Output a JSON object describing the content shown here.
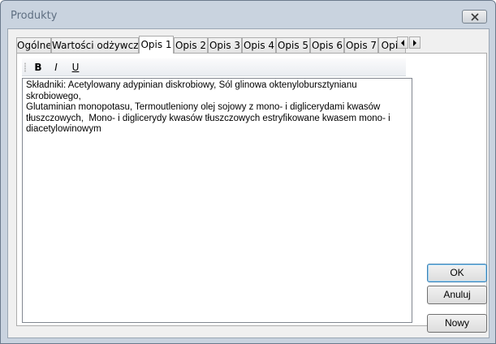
{
  "window": {
    "title": "Produkty"
  },
  "tabs": [
    {
      "label": "Ogólne",
      "active": false
    },
    {
      "label": "Wartości odżywcze",
      "active": false
    },
    {
      "label": "Opis 1",
      "active": true
    },
    {
      "label": "Opis 2",
      "active": false
    },
    {
      "label": "Opis 3",
      "active": false
    },
    {
      "label": "Opis 4",
      "active": false
    },
    {
      "label": "Opis 5",
      "active": false
    },
    {
      "label": "Opis 6",
      "active": false
    },
    {
      "label": "Opis 7",
      "active": false
    },
    {
      "label": "Opis",
      "active": false
    }
  ],
  "toolbar": {
    "bold": "B",
    "italic": "I",
    "underline": "U"
  },
  "editor": {
    "text": "Składniki: Acetylowany adypinian diskrobiowy, Sól glinowa oktenylobursztynianu skrobiowego,\nGlutaminian monopotasu, Termoutleniony olej sojowy z mono- i diglicerydami kwasów\ntłuszczowych,  Mono- i diglicerydy kwasów tłuszczowych estryfikowane kwasem mono- i\ndiacetylowinowym"
  },
  "buttons": {
    "ok": "OK",
    "cancel": "Anuluj",
    "new": "Nowy"
  }
}
